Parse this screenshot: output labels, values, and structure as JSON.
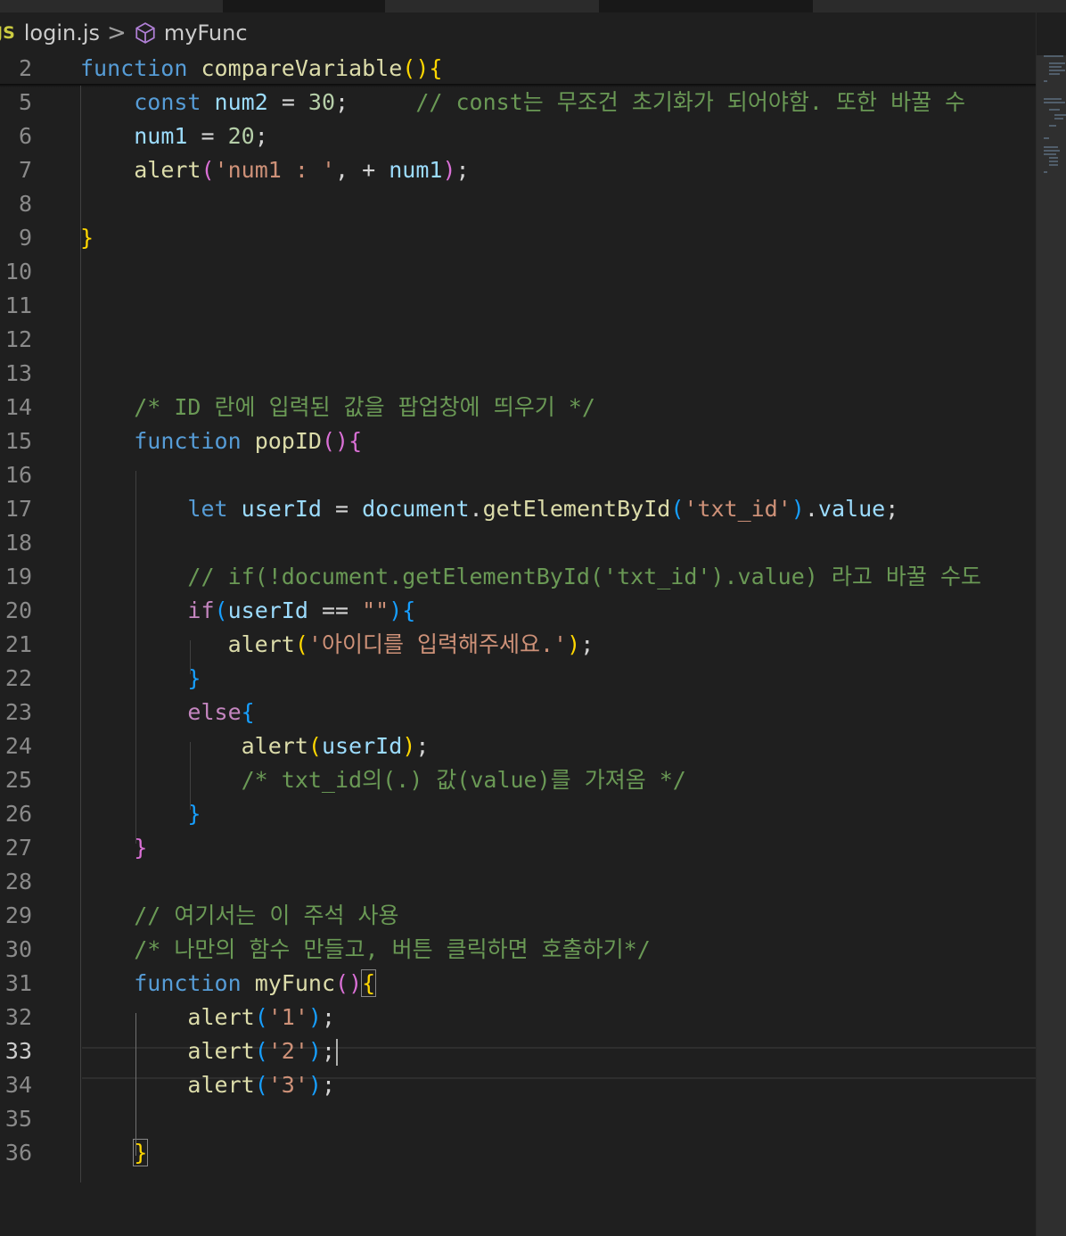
{
  "breadcrumb": {
    "file_badge": "JS",
    "file_name": "login.js",
    "separator": ">",
    "symbol_name": "myFunc"
  },
  "editor": {
    "language": "javascript",
    "current_line": 33,
    "lines": [
      {
        "number": "2",
        "tokens": [
          [
            "kw",
            "function"
          ],
          [
            "p",
            " "
          ],
          [
            "fn",
            "compareVariable"
          ],
          [
            "br1",
            "()"
          ],
          [
            "br1",
            "{"
          ]
        ]
      },
      {
        "number": "5",
        "tokens": [
          [
            "p",
            "    "
          ],
          [
            "kw",
            "const"
          ],
          [
            "p",
            " "
          ],
          [
            "var",
            "num2"
          ],
          [
            "p",
            " = "
          ],
          [
            "num",
            "30"
          ],
          [
            "p",
            ";     "
          ],
          [
            "cmt",
            "// const는 무조건 초기화가 되어야함. 또한 바꿀 수"
          ]
        ]
      },
      {
        "number": "6",
        "tokens": [
          [
            "p",
            "    "
          ],
          [
            "var",
            "num1"
          ],
          [
            "p",
            " = "
          ],
          [
            "num",
            "20"
          ],
          [
            "p",
            ";"
          ]
        ]
      },
      {
        "number": "7",
        "tokens": [
          [
            "p",
            "    "
          ],
          [
            "fn",
            "alert"
          ],
          [
            "br2",
            "("
          ],
          [
            "str",
            "'num1 : '"
          ],
          [
            "p",
            ", + "
          ],
          [
            "var",
            "num1"
          ],
          [
            "br2",
            ")"
          ],
          [
            "p",
            ";"
          ]
        ]
      },
      {
        "number": "8",
        "tokens": []
      },
      {
        "number": "9",
        "tokens": [
          [
            "br1",
            "}"
          ]
        ]
      },
      {
        "number": "10",
        "tokens": []
      },
      {
        "number": "11",
        "tokens": []
      },
      {
        "number": "12",
        "tokens": []
      },
      {
        "number": "13",
        "tokens": []
      },
      {
        "number": "14",
        "tokens": [
          [
            "p",
            "    "
          ],
          [
            "cmt",
            "/* ID 란에 입력된 값을 팝업창에 띄우기 */"
          ]
        ]
      },
      {
        "number": "15",
        "tokens": [
          [
            "p",
            "    "
          ],
          [
            "kw",
            "function"
          ],
          [
            "p",
            " "
          ],
          [
            "fn",
            "popID"
          ],
          [
            "br2",
            "()"
          ],
          [
            "br2",
            "{"
          ]
        ]
      },
      {
        "number": "16",
        "tokens": []
      },
      {
        "number": "17",
        "tokens": [
          [
            "p",
            "        "
          ],
          [
            "kw",
            "let"
          ],
          [
            "p",
            " "
          ],
          [
            "var",
            "userId"
          ],
          [
            "p",
            " = "
          ],
          [
            "var",
            "document"
          ],
          [
            "p",
            "."
          ],
          [
            "fn",
            "getElementById"
          ],
          [
            "br3",
            "("
          ],
          [
            "str",
            "'txt_id'"
          ],
          [
            "br3",
            ")"
          ],
          [
            "p",
            "."
          ],
          [
            "var",
            "value"
          ],
          [
            "p",
            ";"
          ]
        ]
      },
      {
        "number": "18",
        "tokens": []
      },
      {
        "number": "19",
        "tokens": [
          [
            "p",
            "        "
          ],
          [
            "cmt",
            "// if(!document.getElementById('txt_id').value) 라고 바꿀 수도"
          ]
        ]
      },
      {
        "number": "20",
        "tokens": [
          [
            "p",
            "        "
          ],
          [
            "ctl",
            "if"
          ],
          [
            "br3",
            "("
          ],
          [
            "var",
            "userId"
          ],
          [
            "p",
            " == "
          ],
          [
            "str",
            "\"\""
          ],
          [
            "br3",
            ")"
          ],
          [
            "br3",
            "{"
          ]
        ]
      },
      {
        "number": "21",
        "tokens": [
          [
            "p",
            "           "
          ],
          [
            "fn",
            "alert"
          ],
          [
            "br1",
            "("
          ],
          [
            "str",
            "'아이디를 입력해주세요.'"
          ],
          [
            "br1",
            ")"
          ],
          [
            "p",
            ";"
          ]
        ]
      },
      {
        "number": "22",
        "tokens": [
          [
            "p",
            "        "
          ],
          [
            "br3",
            "}"
          ]
        ]
      },
      {
        "number": "23",
        "tokens": [
          [
            "p",
            "        "
          ],
          [
            "ctl",
            "else"
          ],
          [
            "br3",
            "{"
          ]
        ]
      },
      {
        "number": "24",
        "tokens": [
          [
            "p",
            "            "
          ],
          [
            "fn",
            "alert"
          ],
          [
            "br1",
            "("
          ],
          [
            "var",
            "userId"
          ],
          [
            "br1",
            ")"
          ],
          [
            "p",
            ";"
          ]
        ]
      },
      {
        "number": "25",
        "tokens": [
          [
            "p",
            "            "
          ],
          [
            "cmt",
            "/* txt_id의(.) 값(value)를 가져옴 */"
          ]
        ]
      },
      {
        "number": "26",
        "tokens": [
          [
            "p",
            "        "
          ],
          [
            "br3",
            "}"
          ]
        ]
      },
      {
        "number": "27",
        "tokens": [
          [
            "p",
            "    "
          ],
          [
            "br2",
            "}"
          ]
        ]
      },
      {
        "number": "28",
        "tokens": []
      },
      {
        "number": "29",
        "tokens": [
          [
            "p",
            "    "
          ],
          [
            "cmt",
            "// 여기서는 이 주석 사용"
          ]
        ]
      },
      {
        "number": "30",
        "tokens": [
          [
            "p",
            "    "
          ],
          [
            "cmt",
            "/* 나만의 함수 만들고, 버튼 클릭하면 호출하기*/"
          ]
        ]
      },
      {
        "number": "31",
        "tokens": [
          [
            "p",
            "    "
          ],
          [
            "kw",
            "function"
          ],
          [
            "p",
            " "
          ],
          [
            "fn",
            "myFunc"
          ],
          [
            "br2",
            "()"
          ],
          [
            "br1m",
            "{"
          ]
        ]
      },
      {
        "number": "32",
        "tokens": [
          [
            "p",
            "        "
          ],
          [
            "fn",
            "alert"
          ],
          [
            "br3",
            "("
          ],
          [
            "str",
            "'1'"
          ],
          [
            "br3",
            ")"
          ],
          [
            "p",
            ";"
          ]
        ]
      },
      {
        "number": "33",
        "tokens": [
          [
            "p",
            "        "
          ],
          [
            "fn",
            "alert"
          ],
          [
            "br3",
            "("
          ],
          [
            "str",
            "'2'"
          ],
          [
            "br3",
            ")"
          ],
          [
            "p",
            ";"
          ],
          [
            "caret",
            ""
          ]
        ]
      },
      {
        "number": "34",
        "tokens": [
          [
            "p",
            "        "
          ],
          [
            "fn",
            "alert"
          ],
          [
            "br3",
            "("
          ],
          [
            "str",
            "'3'"
          ],
          [
            "br3",
            ")"
          ],
          [
            "p",
            ";"
          ]
        ]
      },
      {
        "number": "35",
        "tokens": []
      },
      {
        "number": "36",
        "tokens": [
          [
            "p",
            "    "
          ],
          [
            "br1m",
            "}"
          ]
        ]
      }
    ]
  },
  "colors": {
    "background": "#1f1f1f",
    "keyword": "#569cd6",
    "control": "#c586c0",
    "function": "#dcdcaa",
    "variable": "#9cdcfe",
    "string": "#ce9178",
    "number": "#b5cea8",
    "comment": "#6a9955"
  },
  "icons": {
    "symbol": "cube-icon"
  }
}
